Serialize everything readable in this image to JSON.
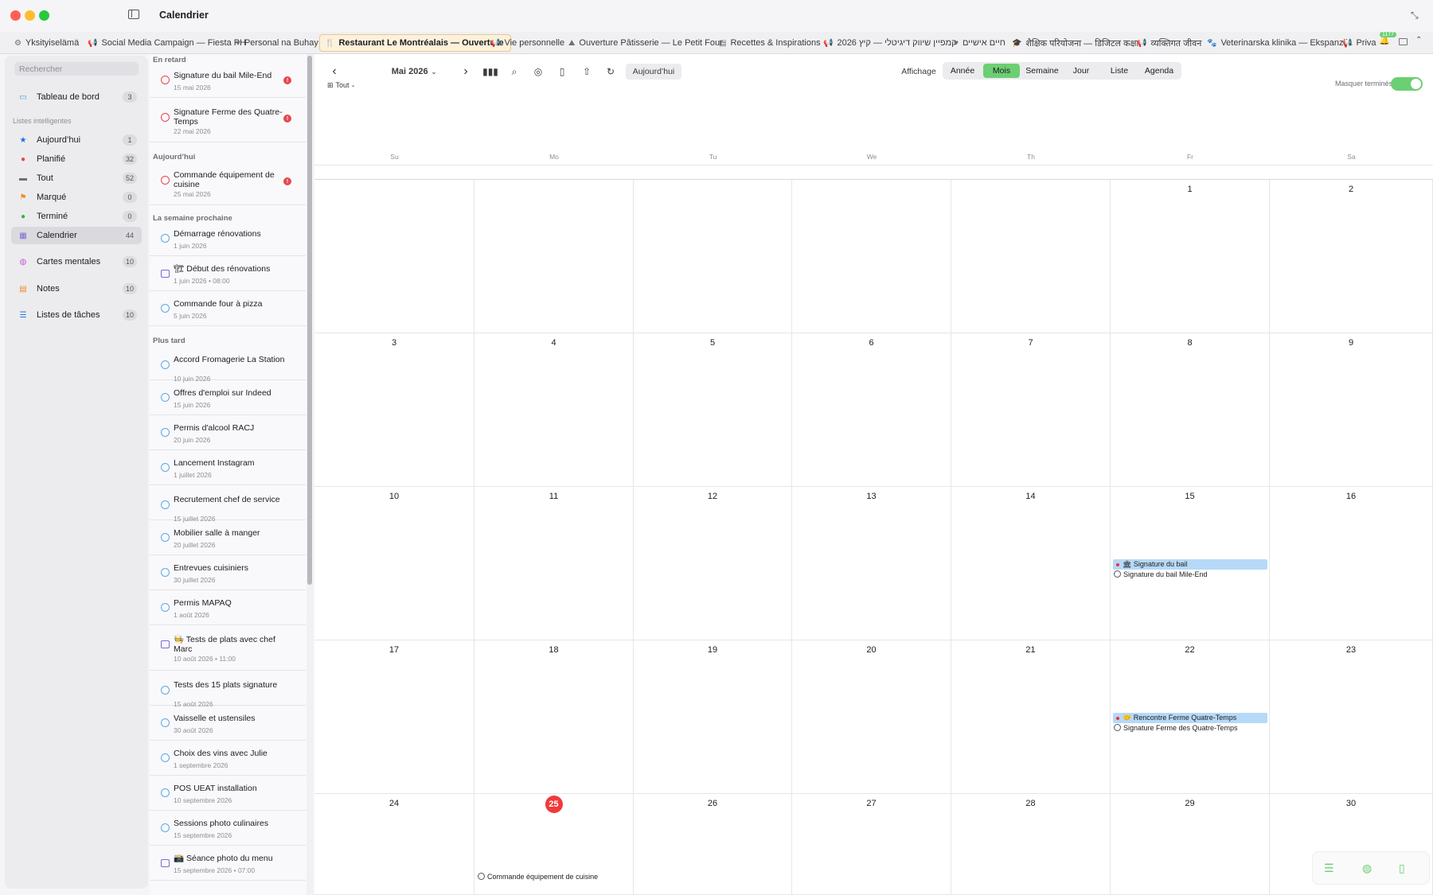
{
  "window": {
    "title": "Calendrier"
  },
  "tabs": [
    {
      "label": "Yksityiselämä",
      "icon": "⚙"
    },
    {
      "label": "Social Media Campaign — Fiesta PH",
      "icon": "📢"
    },
    {
      "label": "Personal na Buhay",
      "icon": "♥"
    },
    {
      "label": "Restaurant Le Montréalais — Ouverture",
      "icon": "🍴",
      "active": true
    },
    {
      "label": "Vie personnelle",
      "icon": "📢"
    },
    {
      "label": "Ouverture Pâtisserie — Le Petit Four",
      "icon": "⛰"
    },
    {
      "label": "Recettes & Inspirations",
      "icon": "▤"
    },
    {
      "label": "קמפיין שיווק דיגיטלי — קיץ 2026",
      "icon": "📢"
    },
    {
      "label": "חיים אישיים",
      "icon": "♥"
    },
    {
      "label": "शैक्षिक परियोजना — डिजिटल कक्षा",
      "icon": "🎓"
    },
    {
      "label": "व्यक्तिगत जीवन",
      "icon": "📢"
    },
    {
      "label": "Veterinarska klinika — Ekspanzija",
      "icon": "🐾"
    },
    {
      "label": "Priva",
      "icon": "📢"
    }
  ],
  "notification_badge": "1177",
  "sidebar": {
    "search_placeholder": "Rechercher",
    "dashboard": {
      "label": "Tableau de bord",
      "count": "3"
    },
    "smart_lists_title": "Listes intelligentes",
    "items": [
      {
        "label": "Aujourd’hui",
        "count": "1",
        "icon": "star-icon",
        "color": "#1e6fe0"
      },
      {
        "label": "Planifié",
        "count": "32",
        "icon": "clock-icon",
        "color": "#e5484d"
      },
      {
        "label": "Tout",
        "count": "52",
        "icon": "tray-icon",
        "color": "#6e6e73"
      },
      {
        "label": "Marqué",
        "count": "0",
        "icon": "flag-icon",
        "color": "#f08a24"
      },
      {
        "label": "Terminé",
        "count": "0",
        "icon": "check-icon",
        "color": "#2fb34a"
      },
      {
        "label": "Calendrier",
        "count": "44",
        "icon": "calendar-icon",
        "color": "#7a69d8",
        "active": true
      }
    ],
    "extras": [
      {
        "label": "Cartes mentales",
        "count": "10",
        "icon": "brain-icon",
        "color": "#c05ad6"
      },
      {
        "label": "Notes",
        "count": "10",
        "icon": "note-icon",
        "color": "#f08a24"
      },
      {
        "label": "Listes de tâches",
        "count": "10",
        "icon": "list-icon",
        "color": "#1e6fe0"
      }
    ]
  },
  "tasklist": {
    "sections": [
      {
        "title": "En retard",
        "tasks": [
          {
            "title": "Signature du bail Mile-End",
            "date": "15 mai 2026",
            "kind": "overdue"
          },
          {
            "title": "Signature Ferme des Quatre-Temps",
            "date": "22 mai 2026",
            "kind": "overdue"
          }
        ]
      },
      {
        "title": "Aujourd’hui",
        "tasks": [
          {
            "title": "Commande équipement de cuisine",
            "date": "25 mai 2026",
            "kind": "overdue"
          }
        ]
      },
      {
        "title": "La semaine prochaine",
        "tasks": [
          {
            "title": "Démarrage rénovations",
            "date": "1 juin 2026",
            "kind": "task"
          },
          {
            "title": "🏗 Début des rénovations",
            "date": "1 juin 2026 • 08:00",
            "kind": "event"
          },
          {
            "title": "Commande four à pizza",
            "date": "5 juin 2026",
            "kind": "task"
          }
        ]
      },
      {
        "title": "Plus tard",
        "tasks": [
          {
            "title": "Accord Fromagerie La Station",
            "date": "10 juin 2026",
            "kind": "task"
          },
          {
            "title": "Offres d'emploi sur Indeed",
            "date": "15 juin 2026",
            "kind": "task"
          },
          {
            "title": "Permis d'alcool RACJ",
            "date": "20 juin 2026",
            "kind": "task"
          },
          {
            "title": "Lancement Instagram",
            "date": "1 juillet 2026",
            "kind": "task"
          },
          {
            "title": "Recrutement chef de service",
            "date": "15 juillet 2026",
            "kind": "task"
          },
          {
            "title": "Mobilier salle à manger",
            "date": "20 juillet 2026",
            "kind": "task"
          },
          {
            "title": "Entrevues cuisiniers",
            "date": "30 juillet 2026",
            "kind": "task"
          },
          {
            "title": "Permis MAPAQ",
            "date": "1 août 2026",
            "kind": "task"
          },
          {
            "title": "🧑‍🍳 Tests de plats avec chef Marc",
            "date": "10 août 2026 • 11:00",
            "kind": "event"
          },
          {
            "title": "Tests des 15 plats signature",
            "date": "15 août 2026",
            "kind": "task"
          },
          {
            "title": "Vaisselle et ustensiles",
            "date": "30 août 2026",
            "kind": "task"
          },
          {
            "title": "Choix des vins avec Julie",
            "date": "1 septembre 2026",
            "kind": "task"
          },
          {
            "title": "POS UEAT installation",
            "date": "10 septembre 2026",
            "kind": "task"
          },
          {
            "title": "Sessions photo culinaires",
            "date": "15 septembre 2026",
            "kind": "task"
          },
          {
            "title": "📸 Séance photo du menu",
            "date": "15 septembre 2026 • 07:00",
            "kind": "event"
          }
        ]
      }
    ]
  },
  "toolbar": {
    "month_label": "Mai 2026",
    "today_label": "Aujourd’hui",
    "view_label": "Affichage",
    "views": [
      "Année",
      "Mois",
      "Semaine",
      "Jour",
      "Liste",
      "Agenda"
    ],
    "active_view": "Mois",
    "filter_label": "Tout",
    "hide_done_label": "Masquer terminés",
    "hide_done_on": true
  },
  "calendar": {
    "weekdays": [
      "Su",
      "Mo",
      "Tu",
      "We",
      "Th",
      "Fr",
      "Sa"
    ],
    "weeks": [
      [
        "",
        "",
        "",
        "",
        "",
        "1",
        "2"
      ],
      [
        "3",
        "4",
        "5",
        "6",
        "7",
        "8",
        "9"
      ],
      [
        "10",
        "11",
        "12",
        "13",
        "14",
        "15",
        "16"
      ],
      [
        "17",
        "18",
        "19",
        "20",
        "21",
        "22",
        "23"
      ],
      [
        "24",
        "25",
        "26",
        "27",
        "28",
        "29",
        "30"
      ]
    ],
    "today": "25",
    "events": [
      {
        "week": 2,
        "day": 5,
        "items": [
          {
            "type": "event",
            "label": "🏛 Signature du bail"
          },
          {
            "type": "task",
            "label": "Signature du bail Mile-End"
          }
        ]
      },
      {
        "week": 3,
        "day": 5,
        "items": [
          {
            "type": "event",
            "label": "🤝 Rencontre Ferme Quatre-Temps"
          },
          {
            "type": "task",
            "label": "Signature Ferme des Quatre-Temps"
          }
        ]
      },
      {
        "week": 4,
        "day": 1,
        "items": [
          {
            "type": "task",
            "label": "Commande équipement de cuisine"
          }
        ]
      }
    ]
  }
}
